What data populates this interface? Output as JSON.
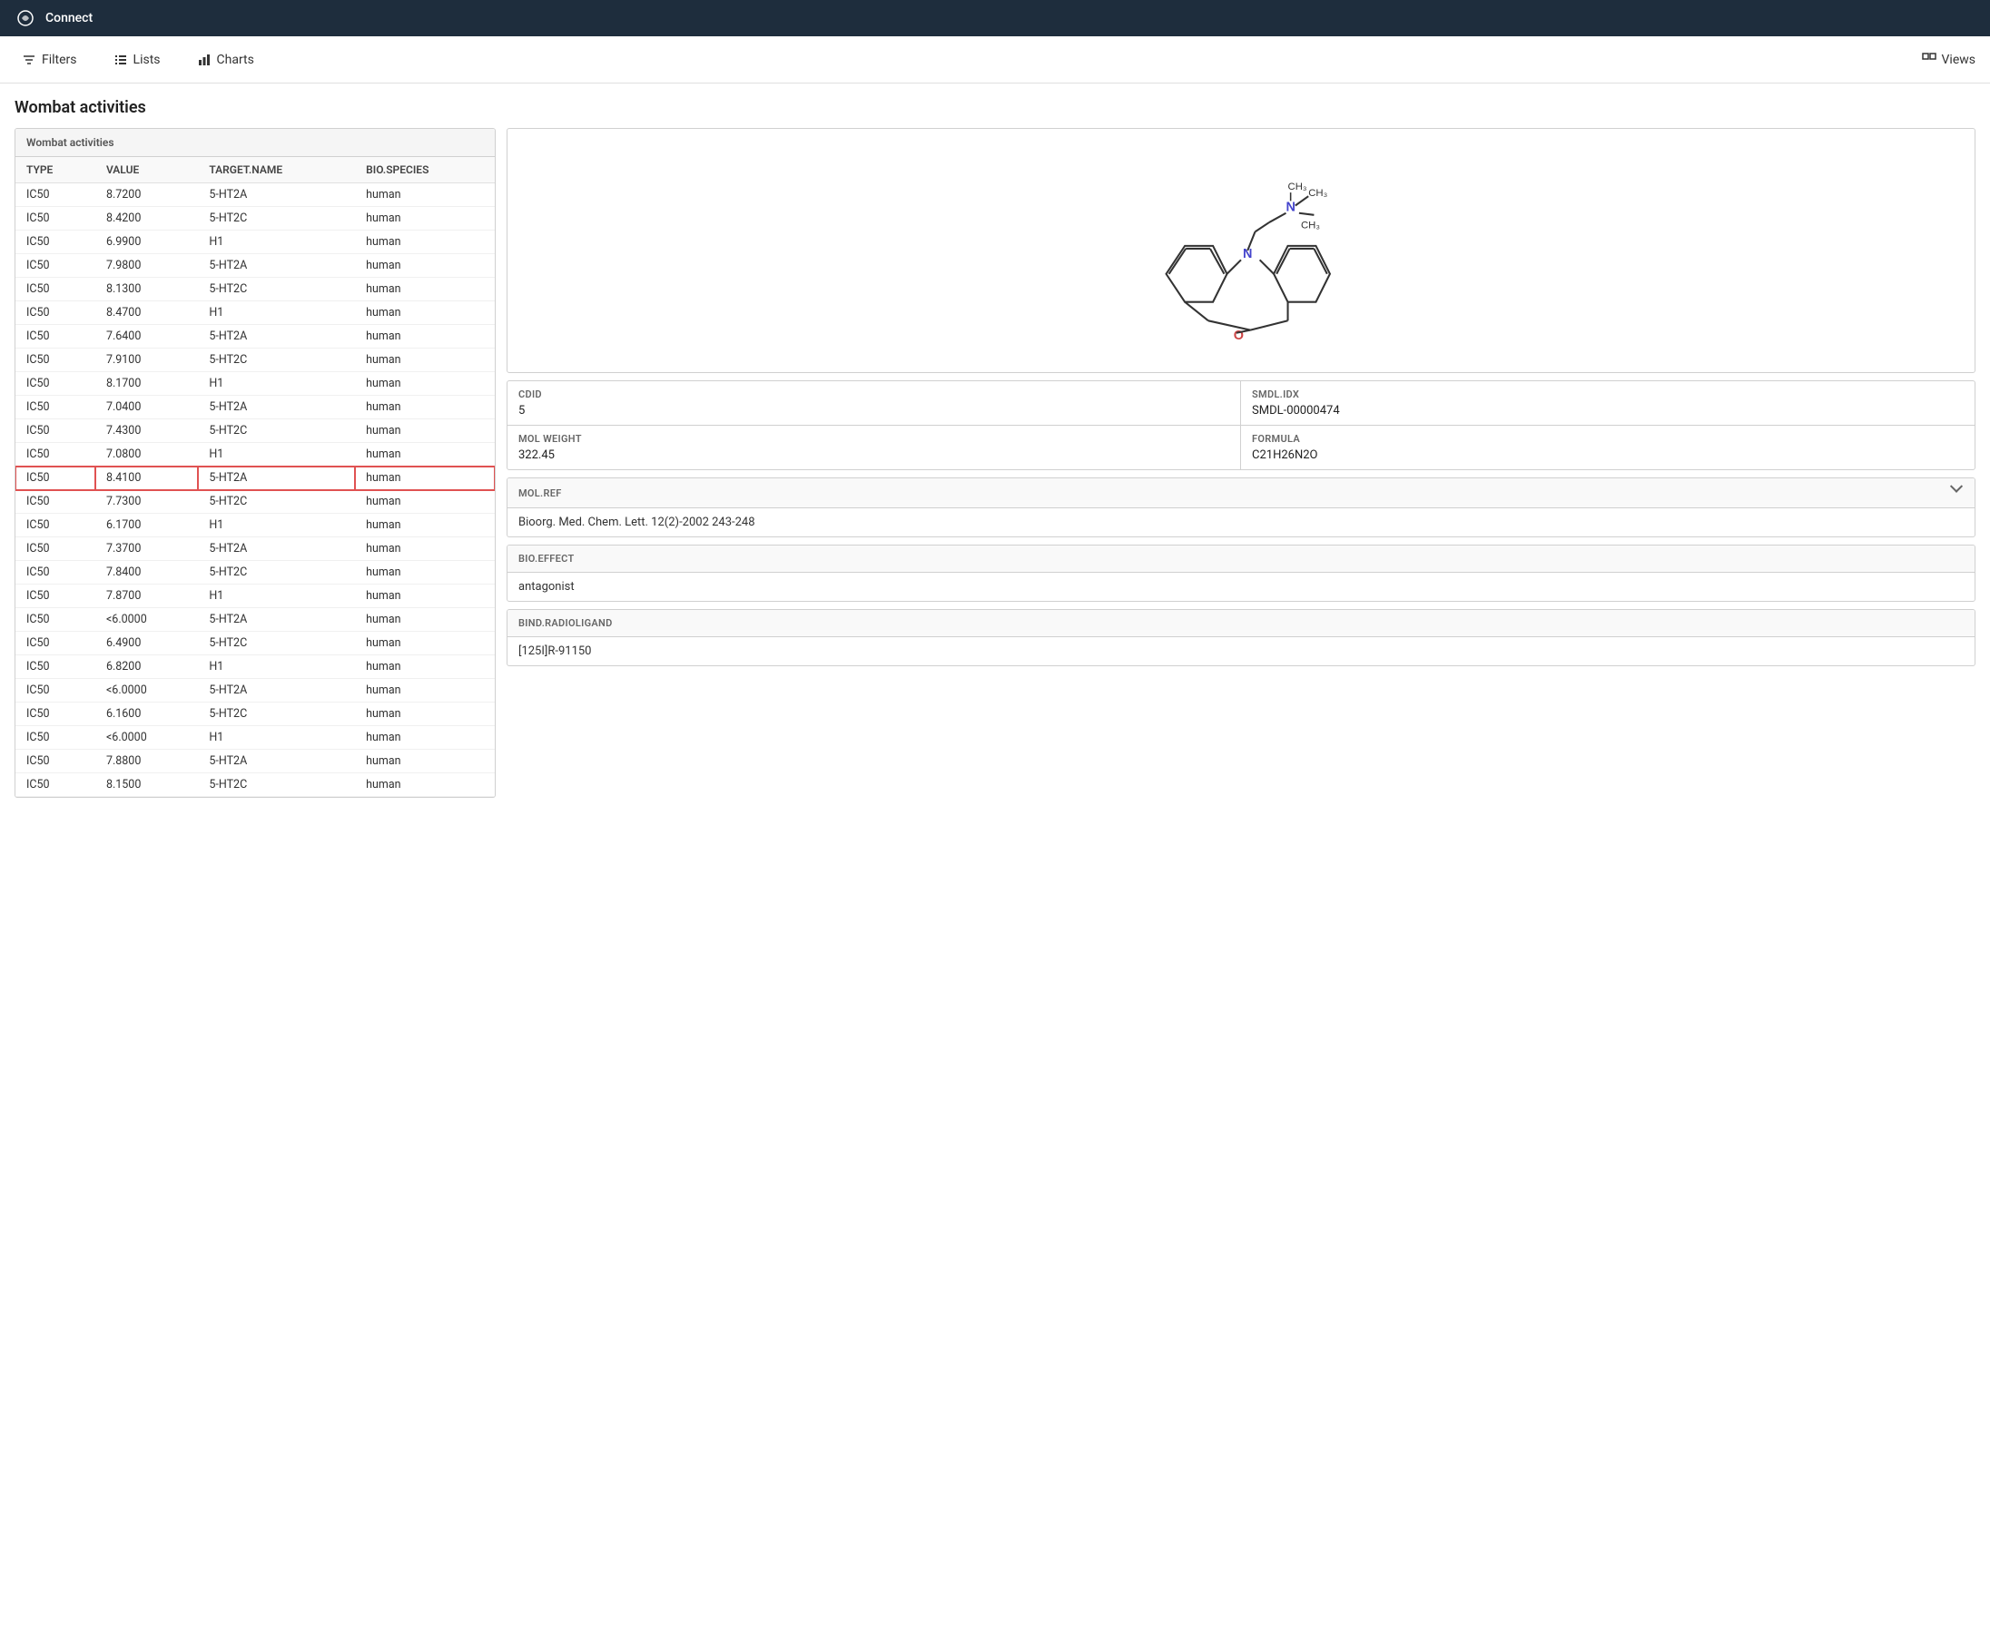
{
  "app": {
    "title": "Connect"
  },
  "toolbar": {
    "filters_label": "Filters",
    "lists_label": "Lists",
    "charts_label": "Charts",
    "views_label": "Views"
  },
  "page": {
    "title": "Wombat activities"
  },
  "table": {
    "header": "Wombat activities",
    "columns": [
      "TYPE",
      "VALUE",
      "TARGET.NAME",
      "BIO.SPECIES"
    ],
    "rows": [
      [
        "IC50",
        "8.7200",
        "5-HT2A",
        "human"
      ],
      [
        "IC50",
        "8.4200",
        "5-HT2C",
        "human"
      ],
      [
        "IC50",
        "6.9900",
        "H1",
        "human"
      ],
      [
        "IC50",
        "7.9800",
        "5-HT2A",
        "human"
      ],
      [
        "IC50",
        "8.1300",
        "5-HT2C",
        "human"
      ],
      [
        "IC50",
        "8.4700",
        "H1",
        "human"
      ],
      [
        "IC50",
        "7.6400",
        "5-HT2A",
        "human"
      ],
      [
        "IC50",
        "7.9100",
        "5-HT2C",
        "human"
      ],
      [
        "IC50",
        "8.1700",
        "H1",
        "human"
      ],
      [
        "IC50",
        "7.0400",
        "5-HT2A",
        "human"
      ],
      [
        "IC50",
        "7.4300",
        "5-HT2C",
        "human"
      ],
      [
        "IC50",
        "7.0800",
        "H1",
        "human"
      ],
      [
        "IC50",
        "8.4100",
        "5-HT2A",
        "human"
      ],
      [
        "IC50",
        "7.7300",
        "5-HT2C",
        "human"
      ],
      [
        "IC50",
        "6.1700",
        "H1",
        "human"
      ],
      [
        "IC50",
        "7.3700",
        "5-HT2A",
        "human"
      ],
      [
        "IC50",
        "7.8400",
        "5-HT2C",
        "human"
      ],
      [
        "IC50",
        "7.8700",
        "H1",
        "human"
      ],
      [
        "IC50",
        "<6.0000",
        "5-HT2A",
        "human"
      ],
      [
        "IC50",
        "6.4900",
        "5-HT2C",
        "human"
      ],
      [
        "IC50",
        "6.8200",
        "H1",
        "human"
      ],
      [
        "IC50",
        "<6.0000",
        "5-HT2A",
        "human"
      ],
      [
        "IC50",
        "6.1600",
        "5-HT2C",
        "human"
      ],
      [
        "IC50",
        "<6.0000",
        "H1",
        "human"
      ],
      [
        "IC50",
        "7.8800",
        "5-HT2A",
        "human"
      ],
      [
        "IC50",
        "8.1500",
        "5-HT2C",
        "human"
      ]
    ],
    "selected_row_index": 12
  },
  "detail": {
    "cdid_label": "CdId",
    "cdid_value": "5",
    "smdl_label": "SMDL.IDX",
    "smdl_value": "SMDL-00000474",
    "molweight_label": "Mol Weight",
    "molweight_value": "322.45",
    "formula_label": "Formula",
    "formula_value": "C21H26N2O",
    "molref_label": "MOL.REF",
    "molref_value": "Bioorg. Med. Chem. Lett. 12(2)-2002 243-248",
    "bioeffect_label": "BIO.EFFECT",
    "bioeffect_value": "antagonist",
    "bind_label": "BIND.RADIOLIGAND",
    "bind_value": "[125I]R-91150"
  }
}
